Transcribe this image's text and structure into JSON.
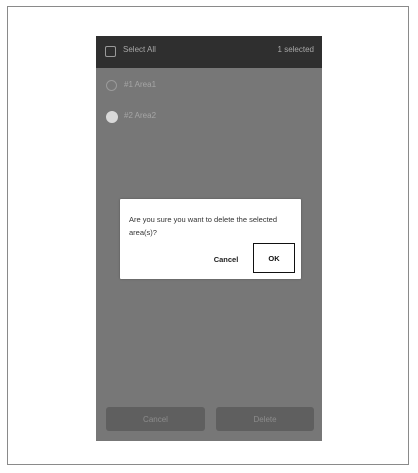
{
  "header": {
    "title": "Select All",
    "count": "1 selected"
  },
  "areas": [
    {
      "label": "#1 Area1",
      "selected": false
    },
    {
      "label": "#2 Area2",
      "selected": true
    }
  ],
  "dialog": {
    "message": "Are you sure you want to delete the selected area(s)?",
    "cancel_label": "Cancel",
    "ok_label": "OK"
  },
  "footer": {
    "cancel_label": "Cancel",
    "delete_label": "Delete"
  }
}
